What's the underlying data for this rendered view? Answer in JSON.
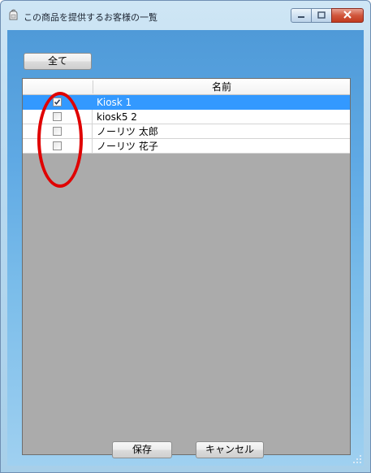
{
  "window": {
    "title": "この商品を提供するお客様の一覧",
    "controls": {
      "minimize": "minimize-icon",
      "maximize": "maximize-icon",
      "close": "close-icon"
    }
  },
  "toolbar": {
    "select_all_label": "全て"
  },
  "table": {
    "column_name_header": "名前",
    "rows": [
      {
        "name": "Kiosk 1",
        "checked": true,
        "selected": true
      },
      {
        "name": "kiosk5 2",
        "checked": false,
        "selected": false
      },
      {
        "name": "ノーリツ 太郎",
        "checked": false,
        "selected": false
      },
      {
        "name": "ノーリツ 花子",
        "checked": false,
        "selected": false
      }
    ]
  },
  "footer": {
    "save_label": "保存",
    "cancel_label": "キャンセル"
  },
  "colors": {
    "selection": "#3399ff",
    "annotation": "#e00000",
    "grid_background": "#ababab"
  }
}
